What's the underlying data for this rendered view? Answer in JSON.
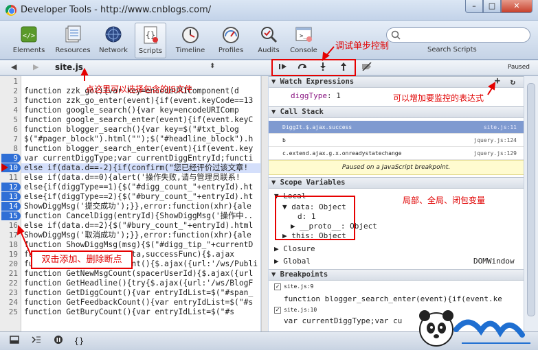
{
  "window": {
    "title": "Developer Tools - http://www.cnblogs.com/",
    "minimize": "–",
    "maximize": "□",
    "close": "✕"
  },
  "toolbar": {
    "items": [
      {
        "label": "Elements",
        "icon": "elements-icon"
      },
      {
        "label": "Resources",
        "icon": "resources-icon"
      },
      {
        "label": "Network",
        "icon": "network-icon"
      },
      {
        "label": "Scripts",
        "icon": "scripts-icon"
      },
      {
        "label": "Timeline",
        "icon": "timeline-icon"
      },
      {
        "label": "Profiles",
        "icon": "profiles-icon"
      },
      {
        "label": "Audits",
        "icon": "audits-icon"
      },
      {
        "label": "Console",
        "icon": "console-icon"
      }
    ],
    "search_label": "Search Scripts"
  },
  "scripts_bar": {
    "back": "◀",
    "forward": "▶",
    "file": "site.js",
    "dropdown": "⬍"
  },
  "debugger": {
    "paused_label": "Paused"
  },
  "code_lines": [
    {
      "n": "1",
      "text": ""
    },
    {
      "n": "2",
      "text": "function zzk_go(){var key=encodeURIComponent(d"
    },
    {
      "n": "3",
      "text": "function zzk_go_enter(event){if(event.keyCode==13"
    },
    {
      "n": "4",
      "text": "function google_search(){var key=encodeURIComp"
    },
    {
      "n": "5",
      "text": "function google_search_enter(event){if(event.keyC"
    },
    {
      "n": "6",
      "text": "function blogger_search(){var key=$(\"#txt_blog"
    },
    {
      "n": "7",
      "text": "$(\"#pager_block\").html(\"\");$(\"#headline_block\").h"
    },
    {
      "n": "8",
      "text": "function blogger_search_enter(event){if(event.key"
    },
    {
      "n": "9",
      "text": "var currentDiggType;var currentDiggEntryId;functi"
    },
    {
      "n": "10",
      "text": "else if(data.d==-2){if(confirm(\"您已经评价过该文章!"
    },
    {
      "n": "11",
      "text": "else if(data.d==0){alert('操作失败,请与管理员联系!"
    },
    {
      "n": "12",
      "text": "else{if(diggType==1){$(\"#digg_count_\"+entryId).ht"
    },
    {
      "n": "13",
      "text": "else{if(diggType==2){$(\"#bury_count_\"+entryId).ht"
    },
    {
      "n": "14",
      "text": "ShowDiggMsg('提交成功');}},error:function(xhr){ale"
    },
    {
      "n": "15",
      "text": "function CancelDigg(entryId){ShowDiggMsg('操作中.."
    },
    {
      "n": "16",
      "text": "else if(data.d==2){$(\"#bury_count_\"+entryId).html"
    },
    {
      "n": "17",
      "text": "ShowDiggMsg('取消成功');}},error:function(xhr){ale"
    },
    {
      "n": "18",
      "text": "function ShowDiggMsg(msg){$(\"#digg_tip_\"+currentD"
    },
    {
      "n": "19",
      "text": "function GetJson(url,data,successFunc){$.ajax"
    },
    {
      "n": "20",
      "text": "function GetBlogUserCount(){$.ajax({url:'/ws/Publi"
    },
    {
      "n": "21",
      "text": "function GetNewMsgCount(spacerUserId){$.ajax({url"
    },
    {
      "n": "22",
      "text": "function GetHeadline(){try{$.ajax({url:'/ws/BlogF"
    },
    {
      "n": "23",
      "text": "function GetDiggCount(){var entryIdList=$(\"#span_"
    },
    {
      "n": "24",
      "text": "function GetFeedbackCount(){var entryIdList=$(\"#s"
    },
    {
      "n": "25",
      "text": "function GetBuryCount(){var entryIdList=$(\"#s"
    }
  ],
  "breakpoint_lines": [
    "9",
    "10",
    "12",
    "13",
    "14",
    "15"
  ],
  "current_line": "10",
  "sidebar": {
    "watch": {
      "title": "Watch Expressions",
      "add": "+",
      "refresh": "↻",
      "items": [
        {
          "name": "diggType",
          "value": "1"
        }
      ]
    },
    "call_stack": {
      "title": "Call Stack",
      "frames": [
        {
          "fn": "DiggIt.$.ajax.success",
          "loc": "site.js:11"
        },
        {
          "fn": "b",
          "loc": "jquery.js:124"
        },
        {
          "fn": "c.extend.ajax.g.x.onreadystatechange",
          "loc": "jquery.js:129"
        }
      ],
      "paused_msg": "Paused on a JavaScript breakpoint."
    },
    "scope": {
      "title": "Scope Variables",
      "local": "Local",
      "data_label": "data: Object",
      "d_label": "d: 1",
      "proto_label": "__proto__: Object",
      "this_label": "this: Object",
      "closure": "Closure",
      "global": "Global",
      "global_value": "DOMWindow"
    },
    "breakpoints": {
      "title": "Breakpoints",
      "items": [
        {
          "loc": "site.js:9",
          "code": "function blogger_search_enter(event){if(event.ke"
        },
        {
          "loc": "site.js:10",
          "code": "var currentDiggType;var cu"
        }
      ]
    }
  },
  "annotations": {
    "step_control": "调试单步控制",
    "choose_js": "点这里可以选择包含的JS文件",
    "add_watch": "可以增加要监控的表达式",
    "scope_vars": "局部、全局、闭包变量",
    "dblclick_bp": "双击添加、删除断点"
  },
  "colors": {
    "accent": "#e60000",
    "breakpoint": "#2f6fd6",
    "selected_frame": "#7f9ad0"
  }
}
